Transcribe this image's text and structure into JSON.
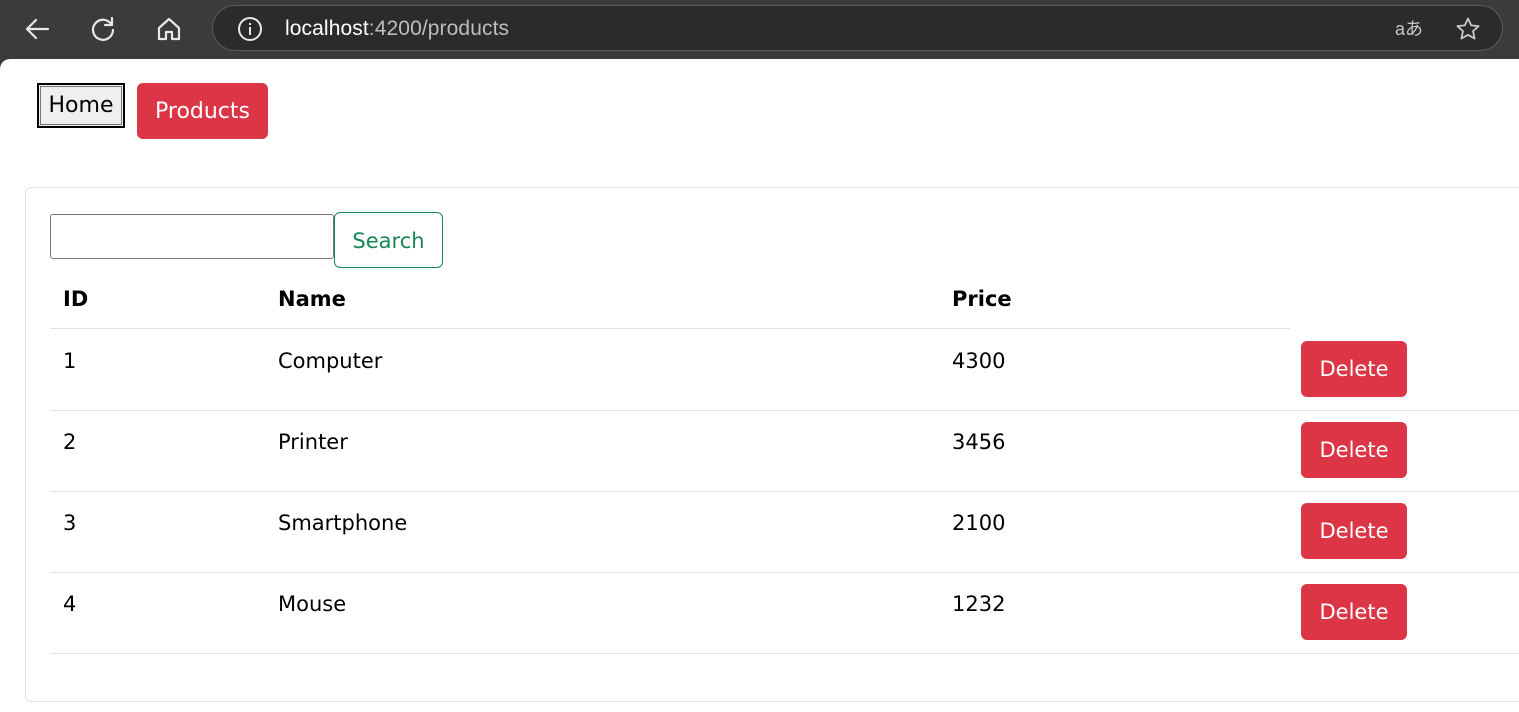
{
  "browser": {
    "back_icon": "arrow-left-icon",
    "reload_icon": "reload-icon",
    "home_icon": "home-icon",
    "url_host": "localhost",
    "url_path": ":4200/products",
    "translate_label": "aあ",
    "star_icon": "star-icon"
  },
  "nav": {
    "home_label": "Home",
    "products_label": "Products"
  },
  "search": {
    "value": "",
    "button_label": "Search"
  },
  "table": {
    "headers": {
      "id": "ID",
      "name": "Name",
      "price": "Price"
    },
    "rows": [
      {
        "id": "1",
        "name": "Computer",
        "price": "4300",
        "action": "Delete"
      },
      {
        "id": "2",
        "name": "Printer",
        "price": "3456",
        "action": "Delete"
      },
      {
        "id": "3",
        "name": "Smartphone",
        "price": "2100",
        "action": "Delete"
      },
      {
        "id": "4",
        "name": "Mouse",
        "price": "1232",
        "action": "Delete"
      }
    ]
  },
  "colors": {
    "danger": "#dc3545",
    "success": "#198754",
    "chrome_bg": "#3b3b3d"
  }
}
